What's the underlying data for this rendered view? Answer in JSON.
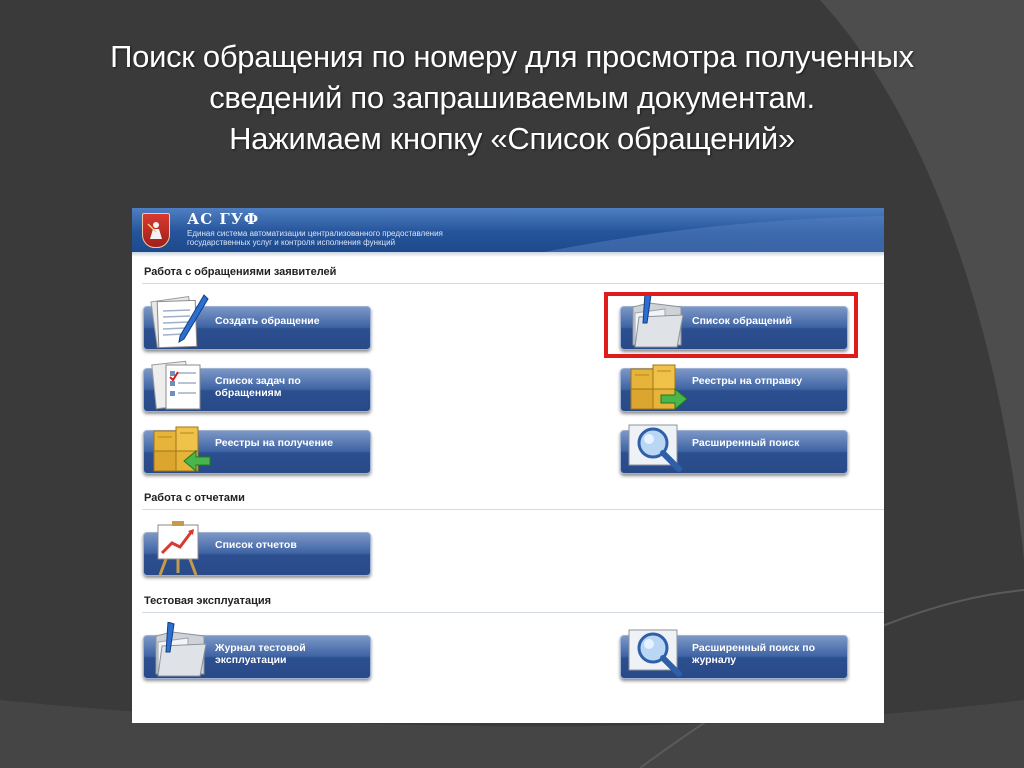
{
  "slide": {
    "title_lines": [
      "Поиск обращения по номеру для просмотра полученных",
      "сведений по запрашиваемым документам.",
      "Нажимаем кнопку «Список обращений»"
    ],
    "background_color": "#3a3a3a",
    "highlight_color": "#e01b1b"
  },
  "app": {
    "name": "АС ГУФ",
    "subtitle_lines": [
      "Единая система автоматизации централизованного предоставления",
      "государственных услуг и контроля исполнения функций"
    ],
    "header_color": "#26549b",
    "tile_color": "#3f64a4"
  },
  "sections": {
    "applications": {
      "title": "Работа с обращениями заявителей",
      "tiles": {
        "create": {
          "label": "Создать обращение",
          "icon": "document-pen-icon"
        },
        "list": {
          "label": "Список обращений",
          "icon": "folder-icon"
        },
        "tasks": {
          "label": "Список задач по обращениям",
          "icon": "task-documents-icon"
        },
        "registries_out": {
          "label": "Реестры на отправку",
          "icon": "boxes-arrow-out-icon"
        },
        "registries_in": {
          "label": "Реестры на получение",
          "icon": "boxes-arrow-in-icon"
        },
        "advanced_search": {
          "label": "Расширенный поиск",
          "icon": "magnifier-icon"
        }
      }
    },
    "reports": {
      "title": "Работа с отчетами",
      "tiles": {
        "reports_list": {
          "label": "Список отчетов",
          "icon": "chart-board-icon"
        }
      }
    },
    "test": {
      "title": "Тестовая эксплуатация",
      "tiles": {
        "journal": {
          "label": "Журнал тестовой эксплуатации",
          "icon": "folder-icon"
        },
        "journal_search": {
          "label": "Расширенный поиск по журналу",
          "icon": "magnifier-icon"
        }
      }
    }
  }
}
